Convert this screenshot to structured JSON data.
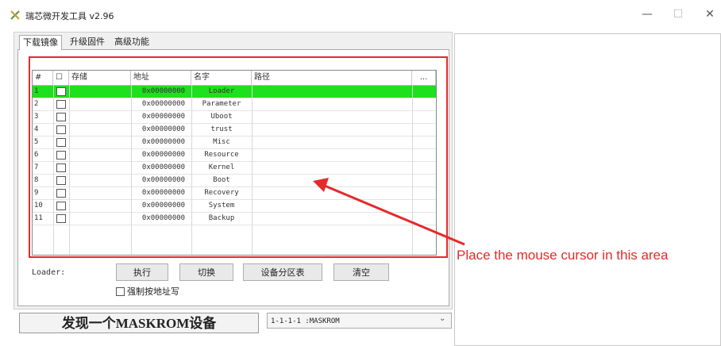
{
  "window": {
    "title": "瑞芯微开发工具 v2.96",
    "controls": {
      "minimize": "—",
      "maximize": "☐",
      "close": "✕"
    }
  },
  "tabs": [
    {
      "label": "下载镜像",
      "active": true
    },
    {
      "label": "升级固件",
      "active": false
    },
    {
      "label": "高级功能",
      "active": false
    }
  ],
  "table": {
    "headers": {
      "idx": "#",
      "check": "☐",
      "storage": "存储",
      "address": "地址",
      "name": "名字",
      "path": "路径",
      "more": "..."
    },
    "rows": [
      {
        "idx": "1",
        "address": "0x00000000",
        "name": "Loader",
        "selected": true
      },
      {
        "idx": "2",
        "address": "0x00000000",
        "name": "Parameter",
        "selected": false
      },
      {
        "idx": "3",
        "address": "0x00000000",
        "name": "Uboot",
        "selected": false
      },
      {
        "idx": "4",
        "address": "0x00000000",
        "name": "trust",
        "selected": false
      },
      {
        "idx": "5",
        "address": "0x00000000",
        "name": "Misc",
        "selected": false
      },
      {
        "idx": "6",
        "address": "0x00000000",
        "name": "Resource",
        "selected": false
      },
      {
        "idx": "7",
        "address": "0x00000000",
        "name": "Kernel",
        "selected": false
      },
      {
        "idx": "8",
        "address": "0x00000000",
        "name": "Boot",
        "selected": false
      },
      {
        "idx": "9",
        "address": "0x00000000",
        "name": "Recovery",
        "selected": false
      },
      {
        "idx": "10",
        "address": "0x00000000",
        "name": "System",
        "selected": false
      },
      {
        "idx": "11",
        "address": "0x00000000",
        "name": "Backup",
        "selected": false
      }
    ]
  },
  "loader_label": "Loader:",
  "buttons": {
    "execute": "执行",
    "switch": "切换",
    "partition_table": "设备分区表",
    "clear": "清空"
  },
  "force_address_label": "强制按地址写",
  "status_text": "发现一个MASKROM设备",
  "device_select": {
    "value": "1-1-1-1 :MASKROM"
  },
  "annotation": {
    "text": "Place the mouse cursor in this area",
    "color": "#e52a2a"
  },
  "colors": {
    "selected_row": "#1ee01e",
    "annotation": "#e52a2a"
  }
}
